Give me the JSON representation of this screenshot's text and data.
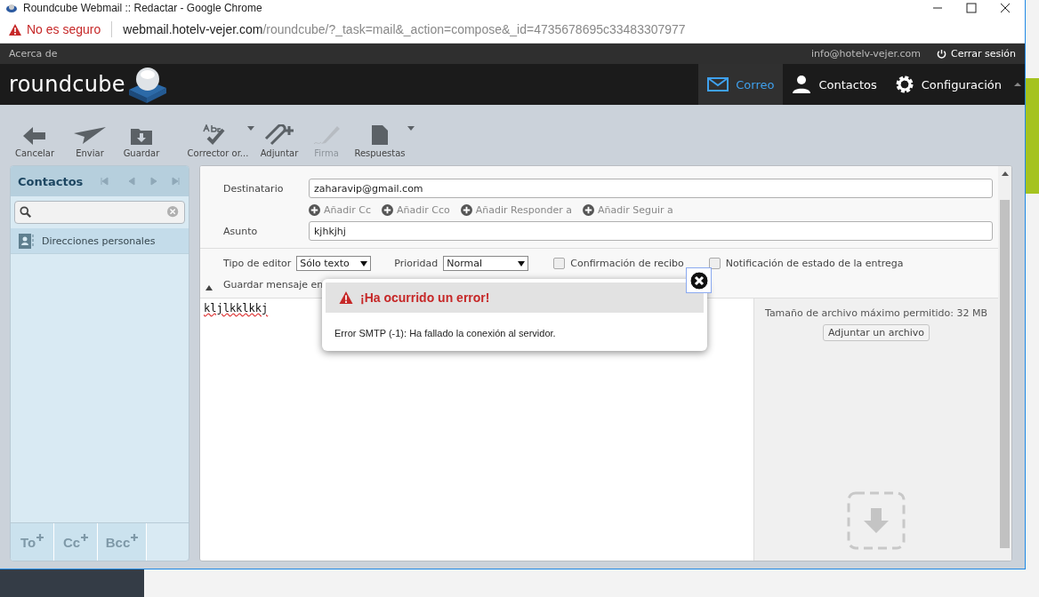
{
  "window": {
    "title": "Roundcube Webmail :: Redactar - Google Chrome"
  },
  "address_bar": {
    "security": "No es seguro",
    "host": "webmail.hotelv-vejer.com",
    "path": "/roundcube/?_task=mail&_action=compose&_id=4735678695c33483307977"
  },
  "topline": {
    "about": "Acerca de",
    "user": "info@hotelv-vejer.com",
    "logout": "Cerrar sesión"
  },
  "logo": "roundcube",
  "nav": [
    {
      "label": "Correo",
      "selected": true
    },
    {
      "label": "Contactos",
      "selected": false
    },
    {
      "label": "Configuración",
      "selected": false
    }
  ],
  "toolbar": [
    {
      "label": "Cancelar",
      "disabled": false,
      "menu": false
    },
    {
      "label": "Enviar",
      "disabled": false,
      "menu": false
    },
    {
      "label": "Guardar",
      "disabled": false,
      "menu": false
    },
    {
      "label": "Corrector or...",
      "disabled": false,
      "menu": true
    },
    {
      "label": "Adjuntar",
      "disabled": false,
      "menu": false
    },
    {
      "label": "Firma",
      "disabled": true,
      "menu": false
    },
    {
      "label": "Respuestas",
      "disabled": false,
      "menu": true
    }
  ],
  "contacts": {
    "title": "Contactos",
    "groups": [
      {
        "label": "Direcciones personales",
        "selected": true
      }
    ],
    "recipient_buttons": [
      "To",
      "Cc",
      "Bcc"
    ]
  },
  "compose": {
    "to_label": "Destinatario",
    "to": "zaharavip@gmail.com",
    "add_links": [
      "Añadir Cc",
      "Añadir Cco",
      "Añadir Responder a",
      "Añadir Seguir a"
    ],
    "subject_label": "Asunto",
    "subject": "kjhkjhj",
    "editor_label": "Tipo de editor",
    "editor": "Sólo texto",
    "priority_label": "Prioridad",
    "priority": "Normal",
    "checks": [
      {
        "label": "Confirmación de recibo",
        "checked": false
      },
      {
        "label": "Notificación de estado de la entrega",
        "checked": false
      }
    ],
    "save_label": "Guardar mensaje en",
    "body": "kljlkklkkj",
    "attach_limit": "Tamaño de archivo máximo permitido: 32 MB",
    "attach_button": "Adjuntar un archivo"
  },
  "error_dialog": {
    "title": "¡Ha ocurrido un error!",
    "message": "Error SMTP (-1): Ha fallado la conexión al servidor."
  }
}
